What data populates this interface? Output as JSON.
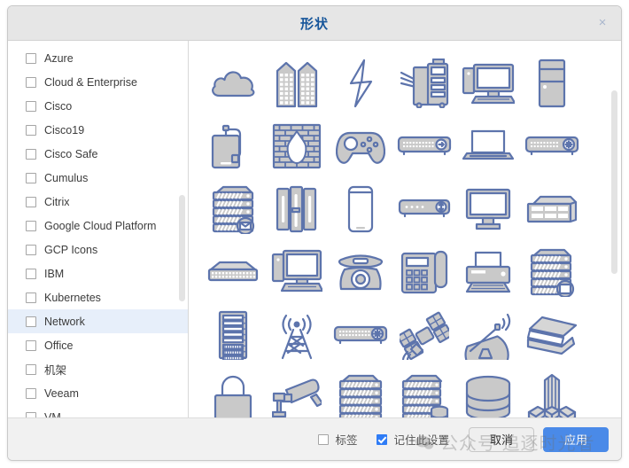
{
  "window": {
    "title": "形状",
    "close_label": "×"
  },
  "sidebar": {
    "items": [
      {
        "label": "Azure",
        "checked": false,
        "selected": false
      },
      {
        "label": "Cloud & Enterprise",
        "checked": false,
        "selected": false
      },
      {
        "label": "Cisco",
        "checked": false,
        "selected": false
      },
      {
        "label": "Cisco19",
        "checked": false,
        "selected": false
      },
      {
        "label": "Cisco Safe",
        "checked": false,
        "selected": false
      },
      {
        "label": "Cumulus",
        "checked": false,
        "selected": false
      },
      {
        "label": "Citrix",
        "checked": false,
        "selected": false
      },
      {
        "label": "Google Cloud Platform",
        "checked": false,
        "selected": false
      },
      {
        "label": "GCP Icons",
        "checked": false,
        "selected": false
      },
      {
        "label": "IBM",
        "checked": false,
        "selected": false
      },
      {
        "label": "Kubernetes",
        "checked": false,
        "selected": false
      },
      {
        "label": "Network",
        "checked": false,
        "selected": true
      },
      {
        "label": "Office",
        "checked": false,
        "selected": false
      },
      {
        "label": "机架",
        "checked": false,
        "selected": false
      },
      {
        "label": "Veeam",
        "checked": false,
        "selected": false
      },
      {
        "label": "VM",
        "checked": false,
        "selected": false
      }
    ]
  },
  "shapes": {
    "columns": 6,
    "items": [
      {
        "name": "cloud"
      },
      {
        "name": "buildings"
      },
      {
        "name": "lightning-bolt"
      },
      {
        "name": "copier"
      },
      {
        "name": "desktop-computer"
      },
      {
        "name": "tower-pc"
      },
      {
        "name": "external-hard-drive"
      },
      {
        "name": "firewall"
      },
      {
        "name": "game-controller"
      },
      {
        "name": "network-switch-arrow"
      },
      {
        "name": "laptop"
      },
      {
        "name": "router-wireless"
      },
      {
        "name": "mail-server"
      },
      {
        "name": "mainframe"
      },
      {
        "name": "smartphone"
      },
      {
        "name": "modem"
      },
      {
        "name": "monitor"
      },
      {
        "name": "rack-server-unit"
      },
      {
        "name": "network-switch"
      },
      {
        "name": "pc-and-monitor"
      },
      {
        "name": "rotary-phone"
      },
      {
        "name": "office-phone"
      },
      {
        "name": "printer"
      },
      {
        "name": "server-stack-display"
      },
      {
        "name": "server-rack"
      },
      {
        "name": "radio-tower"
      },
      {
        "name": "router-wired"
      },
      {
        "name": "satellite"
      },
      {
        "name": "satellite-dish"
      },
      {
        "name": "scanner"
      },
      {
        "name": "padlock"
      },
      {
        "name": "security-camera"
      },
      {
        "name": "server"
      },
      {
        "name": "server-with-database"
      },
      {
        "name": "database"
      },
      {
        "name": "mainframe-tower"
      }
    ]
  },
  "footer": {
    "tags_label": "标签",
    "tags_checked": false,
    "remember_label": "记住此设置",
    "remember_checked": true,
    "cancel_label": "取消",
    "apply_label": "应用"
  },
  "watermark": {
    "text": "公众号  追逐时光者"
  },
  "colors": {
    "title_text": "#16559a",
    "selected_row": "#e7effa",
    "apply_button": "#4a8ae8",
    "checkbox_checked": "#2f7cf6",
    "icon_fill": "#c9c9c9",
    "icon_stroke": "#5d74ac",
    "titlebar_bg": "#e6e6e6",
    "footer_bg": "#f1f1f1"
  }
}
